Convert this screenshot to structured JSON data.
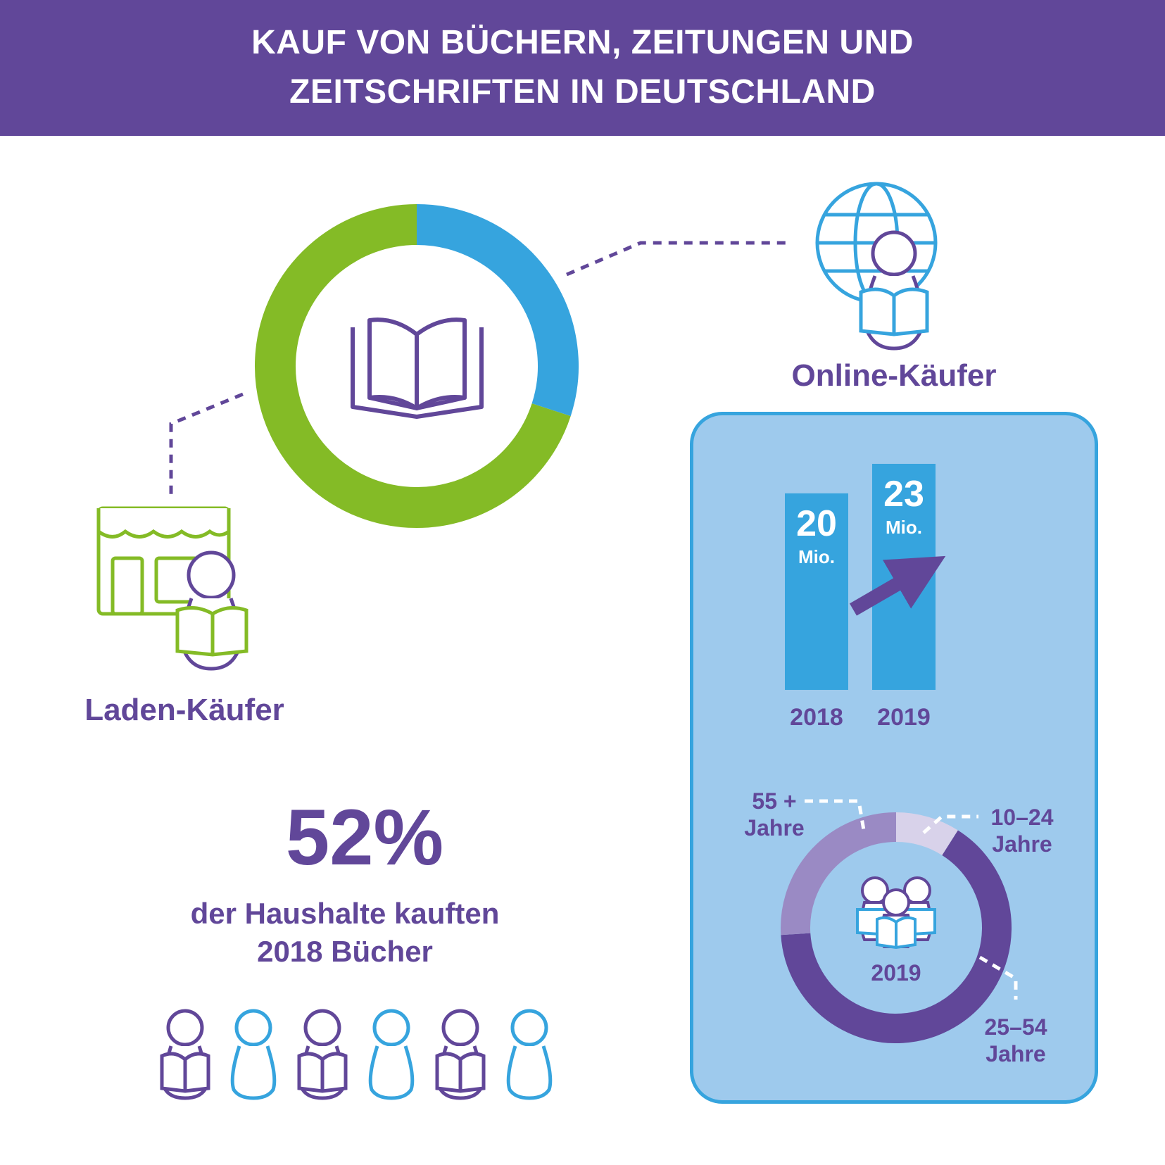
{
  "header": {
    "title_line1": "KAUF VON BÜCHERN, ZEITUNGEN UND",
    "title_line2": "ZEITSCHRIFTEN IN DEUTSCHLAND"
  },
  "colors": {
    "purple": "#614799",
    "blue": "#36a4de",
    "green": "#84bb26",
    "light_blue": "#9ecaed",
    "light_purple": "#9a8ac4",
    "pale_purple": "#d8d2ea"
  },
  "labels": {
    "store_buyers": "Laden-Käufer",
    "online_buyers": "Online-Käufer",
    "stat_percent": "52%",
    "stat_line1": "der Haushalte kauften",
    "stat_line2": "2018 Bücher"
  },
  "icons": [
    "open-book-icon",
    "globe-reader-icon",
    "shop-reader-icon",
    "group-readers-icon",
    "trend-arrow-icon",
    "reader-person-icon",
    "person-icon"
  ],
  "chart_data": [
    {
      "type": "pie",
      "slices": [
        {
          "label": "Online-Käufer",
          "share": 0.3,
          "color": "#36a4de"
        },
        {
          "label": "Laden-Käufer",
          "share": 0.7,
          "color": "#84bb26"
        }
      ]
    },
    {
      "type": "bar",
      "categories": [
        "2018",
        "2019"
      ],
      "values": [
        20,
        23
      ],
      "value_labels": [
        "20",
        "23"
      ],
      "unit": "Mio.",
      "ylim": [
        0,
        24
      ]
    },
    {
      "type": "pie",
      "center_label": "2019",
      "slices": [
        {
          "label_line1": "10–24",
          "label_line2": "Jahre",
          "share": 0.09,
          "color": "#d8d2ea"
        },
        {
          "label_line1": "25–54",
          "label_line2": "Jahre",
          "share": 0.65,
          "color": "#614799"
        },
        {
          "label_line1": "55 +",
          "label_line2": "Jahre",
          "share": 0.26,
          "color": "#9a8ac4"
        }
      ]
    }
  ],
  "people_row": [
    "reader",
    "person",
    "reader",
    "person",
    "reader",
    "person"
  ]
}
